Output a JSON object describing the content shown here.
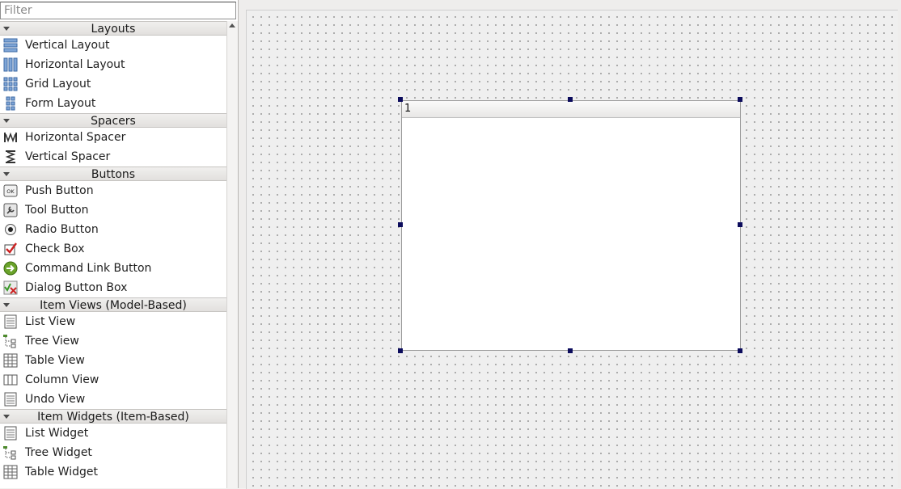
{
  "filter": {
    "placeholder": "Filter",
    "value": ""
  },
  "categories": [
    {
      "label": "Layouts",
      "items": [
        {
          "label": "Vertical Layout",
          "icon": "vertical-layout-icon"
        },
        {
          "label": "Horizontal Layout",
          "icon": "horizontal-layout-icon"
        },
        {
          "label": "Grid Layout",
          "icon": "grid-layout-icon"
        },
        {
          "label": "Form Layout",
          "icon": "form-layout-icon"
        }
      ]
    },
    {
      "label": "Spacers",
      "items": [
        {
          "label": "Horizontal Spacer",
          "icon": "horizontal-spacer-icon"
        },
        {
          "label": "Vertical Spacer",
          "icon": "vertical-spacer-icon"
        }
      ]
    },
    {
      "label": "Buttons",
      "items": [
        {
          "label": "Push Button",
          "icon": "push-button-icon",
          "icon_text": "OK"
        },
        {
          "label": "Tool Button",
          "icon": "tool-button-icon"
        },
        {
          "label": "Radio Button",
          "icon": "radio-button-icon"
        },
        {
          "label": "Check Box",
          "icon": "check-box-icon"
        },
        {
          "label": "Command Link Button",
          "icon": "command-link-icon"
        },
        {
          "label": "Dialog Button Box",
          "icon": "dialog-button-box-icon"
        }
      ]
    },
    {
      "label": "Item Views (Model-Based)",
      "items": [
        {
          "label": "List View",
          "icon": "list-view-icon"
        },
        {
          "label": "Tree View",
          "icon": "tree-view-icon"
        },
        {
          "label": "Table View",
          "icon": "table-view-icon"
        },
        {
          "label": "Column View",
          "icon": "column-view-icon"
        },
        {
          "label": "Undo View",
          "icon": "undo-view-icon"
        }
      ]
    },
    {
      "label": "Item Widgets (Item-Based)",
      "items": [
        {
          "label": "List Widget",
          "icon": "list-widget-icon"
        },
        {
          "label": "Tree Widget",
          "icon": "tree-widget-icon"
        },
        {
          "label": "Table Widget",
          "icon": "table-widget-icon"
        }
      ]
    }
  ],
  "form": {
    "widget_header": "1"
  },
  "colors": {
    "handle": "#0b0b5c",
    "command_link": "#6aa32a",
    "check_mark": "#cc2222"
  }
}
